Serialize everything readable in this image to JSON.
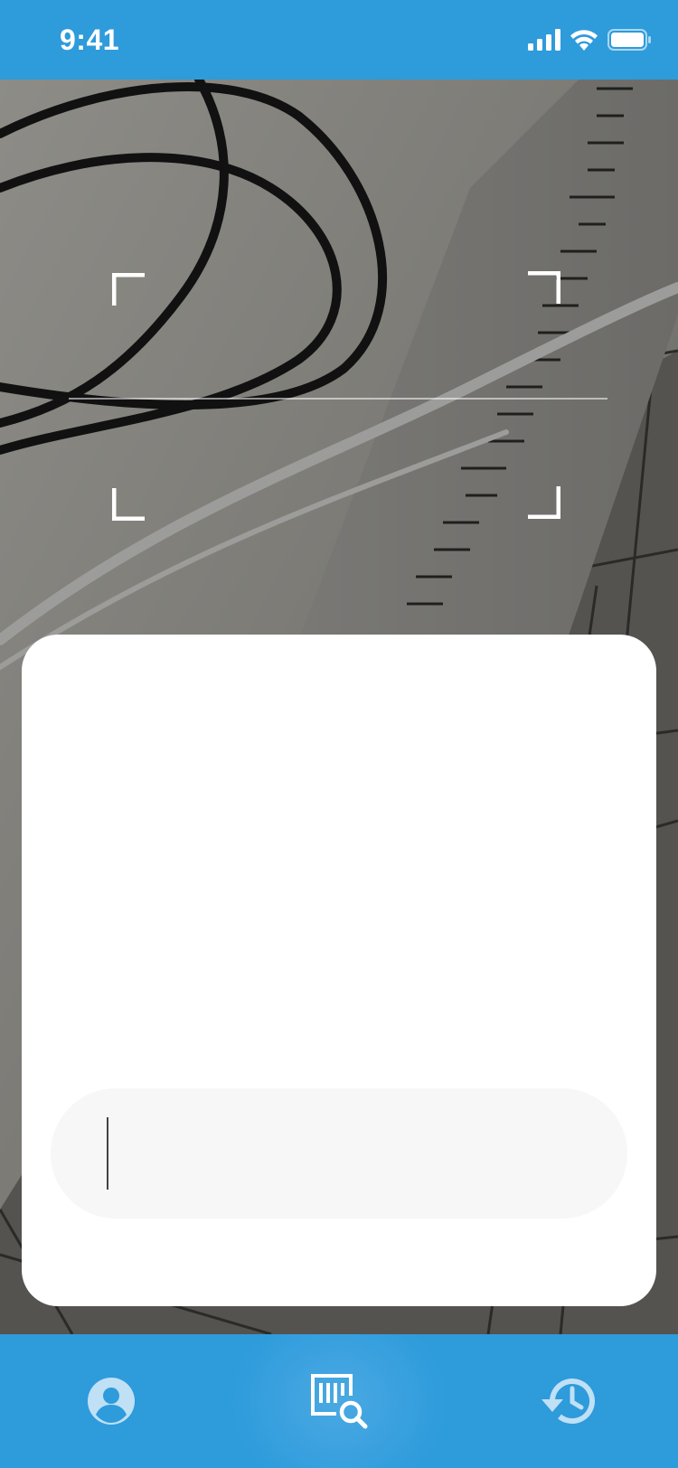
{
  "status_bar": {
    "time": "9:41",
    "icons": [
      "signal-icon",
      "wifi-icon",
      "battery-icon"
    ]
  },
  "viewfinder": {
    "frame_icons": [
      "scan-corner-top-left",
      "scan-corner-top-right",
      "scan-corner-bottom-left",
      "scan-corner-bottom-right"
    ]
  },
  "result_card": {
    "input_value": "",
    "input_placeholder": ""
  },
  "tab_bar": {
    "tabs": [
      {
        "icon": "profile-icon",
        "active": false
      },
      {
        "icon": "barcode-search-icon",
        "active": true
      },
      {
        "icon": "history-icon",
        "active": false
      }
    ]
  },
  "colors": {
    "brand_blue": "#2e9bdb",
    "icon_light": "#bfe0f5",
    "card_bg": "#ffffff",
    "input_bg": "#f7f7f7"
  }
}
